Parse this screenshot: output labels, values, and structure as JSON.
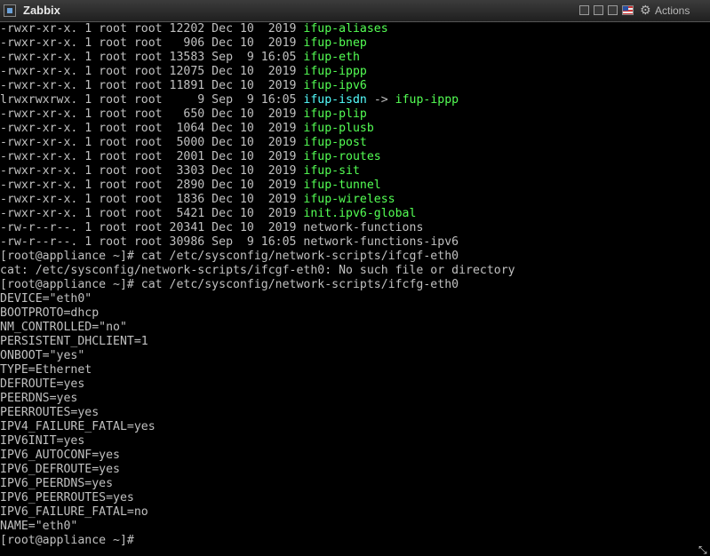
{
  "window": {
    "title": "Zabbix",
    "actions_label": "Actions",
    "flag_icon": "us-flag-icon",
    "gear_icon": "gear-icon"
  },
  "colors": {
    "background": "#000000",
    "text": "#c0c0c0",
    "exec": "#54ff54",
    "link": "#54ffff"
  },
  "listing": [
    {
      "perms": "-rwxr-xr-x.",
      "links": "1",
      "owner": "root",
      "group": "root",
      "size": "12202",
      "month": "Dec",
      "day": "10",
      "time": "2019",
      "name": "ifup-aliases",
      "type": "exec"
    },
    {
      "perms": "-rwxr-xr-x.",
      "links": "1",
      "owner": "root",
      "group": "root",
      "size": "906",
      "month": "Dec",
      "day": "10",
      "time": "2019",
      "name": "ifup-bnep",
      "type": "exec"
    },
    {
      "perms": "-rwxr-xr-x.",
      "links": "1",
      "owner": "root",
      "group": "root",
      "size": "13583",
      "month": "Sep",
      "day": "9",
      "time": "16:05",
      "name": "ifup-eth",
      "type": "exec"
    },
    {
      "perms": "-rwxr-xr-x.",
      "links": "1",
      "owner": "root",
      "group": "root",
      "size": "12075",
      "month": "Dec",
      "day": "10",
      "time": "2019",
      "name": "ifup-ippp",
      "type": "exec"
    },
    {
      "perms": "-rwxr-xr-x.",
      "links": "1",
      "owner": "root",
      "group": "root",
      "size": "11891",
      "month": "Dec",
      "day": "10",
      "time": "2019",
      "name": "ifup-ipv6",
      "type": "exec"
    },
    {
      "perms": "lrwxrwxrwx.",
      "links": "1",
      "owner": "root",
      "group": "root",
      "size": "9",
      "month": "Sep",
      "day": "9",
      "time": "16:05",
      "name": "ifup-isdn",
      "type": "link",
      "target": "ifup-ippp"
    },
    {
      "perms": "-rwxr-xr-x.",
      "links": "1",
      "owner": "root",
      "group": "root",
      "size": "650",
      "month": "Dec",
      "day": "10",
      "time": "2019",
      "name": "ifup-plip",
      "type": "exec"
    },
    {
      "perms": "-rwxr-xr-x.",
      "links": "1",
      "owner": "root",
      "group": "root",
      "size": "1064",
      "month": "Dec",
      "day": "10",
      "time": "2019",
      "name": "ifup-plusb",
      "type": "exec"
    },
    {
      "perms": "-rwxr-xr-x.",
      "links": "1",
      "owner": "root",
      "group": "root",
      "size": "5000",
      "month": "Dec",
      "day": "10",
      "time": "2019",
      "name": "ifup-post",
      "type": "exec"
    },
    {
      "perms": "-rwxr-xr-x.",
      "links": "1",
      "owner": "root",
      "group": "root",
      "size": "2001",
      "month": "Dec",
      "day": "10",
      "time": "2019",
      "name": "ifup-routes",
      "type": "exec"
    },
    {
      "perms": "-rwxr-xr-x.",
      "links": "1",
      "owner": "root",
      "group": "root",
      "size": "3303",
      "month": "Dec",
      "day": "10",
      "time": "2019",
      "name": "ifup-sit",
      "type": "exec"
    },
    {
      "perms": "-rwxr-xr-x.",
      "links": "1",
      "owner": "root",
      "group": "root",
      "size": "2890",
      "month": "Dec",
      "day": "10",
      "time": "2019",
      "name": "ifup-tunnel",
      "type": "exec"
    },
    {
      "perms": "-rwxr-xr-x.",
      "links": "1",
      "owner": "root",
      "group": "root",
      "size": "1836",
      "month": "Dec",
      "day": "10",
      "time": "2019",
      "name": "ifup-wireless",
      "type": "exec"
    },
    {
      "perms": "-rwxr-xr-x.",
      "links": "1",
      "owner": "root",
      "group": "root",
      "size": "5421",
      "month": "Dec",
      "day": "10",
      "time": "2019",
      "name": "init.ipv6-global",
      "type": "exec"
    },
    {
      "perms": "-rw-r--r--.",
      "links": "1",
      "owner": "root",
      "group": "root",
      "size": "20341",
      "month": "Dec",
      "day": "10",
      "time": "2019",
      "name": "network-functions",
      "type": "plain"
    },
    {
      "perms": "-rw-r--r--.",
      "links": "1",
      "owner": "root",
      "group": "root",
      "size": "30986",
      "month": "Sep",
      "day": "9",
      "time": "16:05",
      "name": "network-functions-ipv6",
      "type": "plain"
    }
  ],
  "session": [
    "[root@appliance ~]# cat /etc/sysconfig/network-scripts/ifcgf-eth0",
    "cat: /etc/sysconfig/network-scripts/ifcgf-eth0: No such file or directory",
    "[root@appliance ~]# cat /etc/sysconfig/network-scripts/ifcfg-eth0",
    "DEVICE=\"eth0\"",
    "BOOTPROTO=dhcp",
    "NM_CONTROLLED=\"no\"",
    "PERSISTENT_DHCLIENT=1",
    "ONBOOT=\"yes\"",
    "TYPE=Ethernet",
    "DEFROUTE=yes",
    "PEERDNS=yes",
    "PEERROUTES=yes",
    "IPV4_FAILURE_FATAL=yes",
    "IPV6INIT=yes",
    "IPV6_AUTOCONF=yes",
    "IPV6_DEFROUTE=yes",
    "IPV6_PEERDNS=yes",
    "IPV6_PEERROUTES=yes",
    "IPV6_FAILURE_FATAL=no",
    "NAME=\"eth0\"",
    "[root@appliance ~]#"
  ]
}
